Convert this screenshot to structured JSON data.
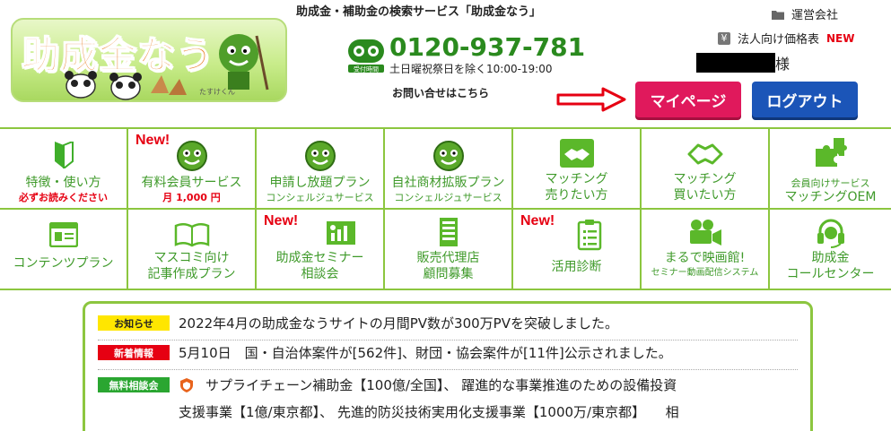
{
  "header": {
    "logo_text": "助成金なう",
    "logo_small": "たすけくん",
    "site_title": "助成金・補助金の検索サービス「助成金なう」",
    "phone_number": "0120-937-781",
    "phone_badge": "受付時間",
    "phone_hours": "土日曜祝祭日を除く10:00-19:00",
    "contact_link": "お問い合せはこちら",
    "company_link": "運営会社",
    "pricing_link": "法人向け価格表",
    "pricing_new": "NEW",
    "user_suffix": "様",
    "mypage_button": "マイページ",
    "logout_button": "ログアウト"
  },
  "nav": {
    "row1": [
      {
        "icon": "beginner-mark-icon",
        "label": "特徴・使い方",
        "sub": "必ずお読みください",
        "sub_red": true,
        "new": ""
      },
      {
        "icon": "mascot-face-icon",
        "label": "有料会員サービス",
        "sub": "月 1,000 円",
        "sub_red": true,
        "new": "New!"
      },
      {
        "icon": "mascot-face-icon",
        "label": "申請し放題プラン",
        "sub": "コンシェルジュサービス",
        "sub_red": false,
        "new": ""
      },
      {
        "icon": "mascot-face-icon",
        "label": "自社商材拡販プラン",
        "sub": "コンシェルジュサービス",
        "sub_red": false,
        "new": ""
      },
      {
        "icon": "handshake-icon",
        "label": "マッチング",
        "label2": "売りたい方",
        "new": ""
      },
      {
        "icon": "handshake-icon",
        "label": "マッチング",
        "label2": "買いたい方",
        "new": ""
      },
      {
        "icon": "puzzle-icon",
        "label": "会員向けサービス",
        "label2": "マッチングOEM",
        "new": ""
      }
    ],
    "row2": [
      {
        "icon": "browser-window-icon",
        "label": "コンテンツプラン",
        "label2": "",
        "new": ""
      },
      {
        "icon": "open-book-icon",
        "label": "マスコミ向け",
        "label2": "記事作成プラン",
        "new": ""
      },
      {
        "icon": "presentation-icon",
        "label": "助成金セミナー",
        "label2": "相談会",
        "new": "New!"
      },
      {
        "icon": "building-icon",
        "label": "販売代理店",
        "label2": "顧問募集",
        "new": ""
      },
      {
        "icon": "clipboard-icon",
        "label": "活用診断",
        "label2": "",
        "new": "New!"
      },
      {
        "icon": "video-camera-icon",
        "label": "まるで映画館!",
        "label2": "セミナー動画配信システム",
        "new": ""
      },
      {
        "icon": "headset-icon",
        "label": "助成金",
        "label2": "コールセンター",
        "new": ""
      }
    ]
  },
  "news": [
    {
      "tag": "お知らせ",
      "color": "yellow",
      "text": "2022年4月の助成金なうサイトの月間PV数が300万PVを突破しました。"
    },
    {
      "tag": "新着情報",
      "color": "red",
      "text": "5月10日　国・自治体案件が[562件]、財団・協会案件が[11件]公示されました。"
    },
    {
      "tag": "無料相談会",
      "color": "green",
      "line1": "サプライチェーン補助金【100億/全国】、 躍進的な事業推進のための設備投資",
      "line2": "支援事業【1億/東京都】、 先進的防災技術実用化支援事業【1000万/東京都】　　相"
    }
  ],
  "colors": {
    "accent_green": "#8cc63f",
    "text_green": "#3f9a2a",
    "mypage": "#e0195c",
    "logout": "#1b55b8"
  }
}
